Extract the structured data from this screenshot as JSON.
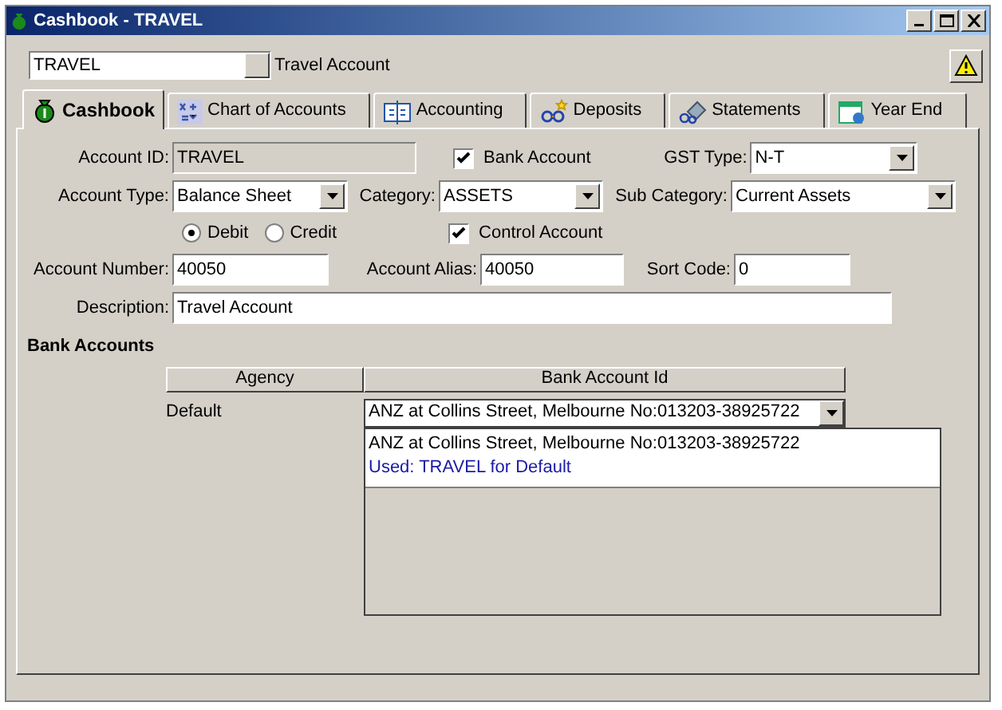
{
  "window": {
    "title": "Cashbook - TRAVEL"
  },
  "account_picker": {
    "value": "TRAVEL",
    "name": "Travel Account"
  },
  "tabs": [
    {
      "label": "Cashbook",
      "selected": true
    },
    {
      "label": "Chart of Accounts",
      "selected": false
    },
    {
      "label": "Accounting",
      "selected": false
    },
    {
      "label": "Deposits",
      "selected": false
    },
    {
      "label": "Statements",
      "selected": false
    },
    {
      "label": "Year End",
      "selected": false
    }
  ],
  "form": {
    "account_id": {
      "label": "Account ID:",
      "value": "TRAVEL"
    },
    "bank_account": {
      "label": "Bank Account",
      "checked": true
    },
    "gst_type": {
      "label": "GST Type:",
      "value": "N-T"
    },
    "account_type": {
      "label": "Account Type:",
      "value": "Balance Sheet"
    },
    "category": {
      "label": "Category:",
      "value": "ASSETS"
    },
    "sub_category": {
      "label": "Sub Category:",
      "value": "Current Assets"
    },
    "balance": [
      {
        "label": "Debit",
        "selected": true
      },
      {
        "label": "Credit",
        "selected": false
      }
    ],
    "control_account": {
      "label": "Control Account",
      "checked": true
    },
    "account_number": {
      "label": "Account Number:",
      "value": "40050"
    },
    "account_alias": {
      "label": "Account Alias:",
      "value": "40050"
    },
    "sort_code": {
      "label": "Sort Code:",
      "value": "0"
    },
    "description": {
      "label": "Description:",
      "value": "Travel Account"
    }
  },
  "bank_accounts": {
    "title": "Bank Accounts",
    "columns": [
      "Agency",
      "Bank Account Id"
    ],
    "rows": [
      {
        "agency": "Default",
        "bank_account_id": "ANZ at Collins Street, Melbourne No:013203-38925722"
      }
    ],
    "dropdown_list": [
      {
        "kind": "option",
        "text": "ANZ at Collins Street, Melbourne No:013203-38925722"
      },
      {
        "kind": "note",
        "text": "Used: TRAVEL for Default"
      }
    ]
  }
}
